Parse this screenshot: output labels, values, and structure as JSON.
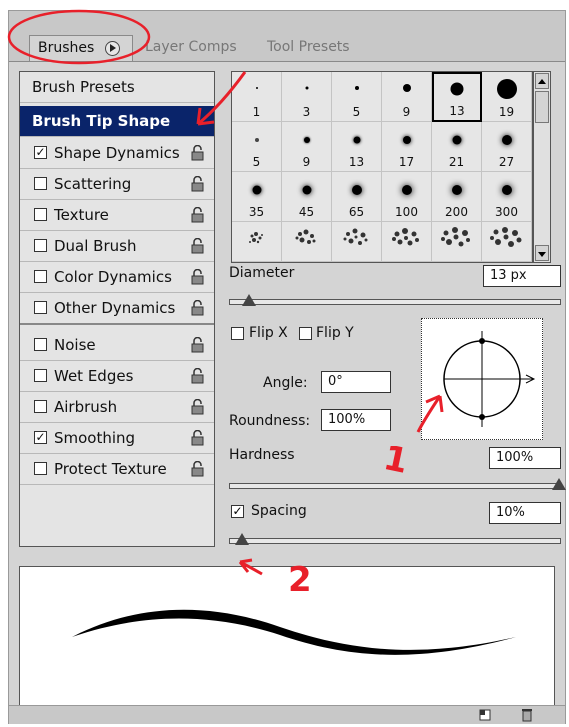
{
  "tabs": [
    {
      "label": "Brushes"
    },
    {
      "label": "Layer Comps"
    },
    {
      "label": "Tool Presets"
    }
  ],
  "left_panel": {
    "items": [
      {
        "label": "Brush Presets"
      },
      {
        "label": "Brush Tip Shape"
      },
      {
        "label": "Shape Dynamics",
        "checked": "✓"
      },
      {
        "label": "Scattering",
        "checked": ""
      },
      {
        "label": "Texture",
        "checked": ""
      },
      {
        "label": "Dual Brush",
        "checked": ""
      },
      {
        "label": "Color Dynamics",
        "checked": ""
      },
      {
        "label": "Other Dynamics",
        "checked": ""
      },
      {
        "label": "Noise",
        "checked": ""
      },
      {
        "label": "Wet Edges",
        "checked": ""
      },
      {
        "label": "Airbrush",
        "checked": ""
      },
      {
        "label": "Smoothing",
        "checked": "✓"
      },
      {
        "label": "Protect Texture",
        "checked": ""
      }
    ]
  },
  "brush_grid": {
    "sizes": [
      "1",
      "3",
      "5",
      "9",
      "13",
      "19",
      "5",
      "9",
      "13",
      "17",
      "21",
      "27",
      "35",
      "45",
      "65",
      "100",
      "200",
      "300"
    ],
    "selected": "13"
  },
  "controls": {
    "diameter_label": "Diameter",
    "diameter_value": "13 px",
    "flip_x_label": "Flip X",
    "flip_y_label": "Flip Y",
    "angle_label": "Angle:",
    "angle_value": "0°",
    "roundness_label": "Roundness:",
    "roundness_value": "100%",
    "hardness_label": "Hardness",
    "hardness_value": "100%",
    "spacing_label": "Spacing",
    "spacing_value": "10%",
    "spacing_checked": "✓"
  },
  "annotations": {
    "one": "1",
    "two": "2"
  },
  "colors": {
    "selection": "#0a246a",
    "annotation": "#e8202a"
  }
}
